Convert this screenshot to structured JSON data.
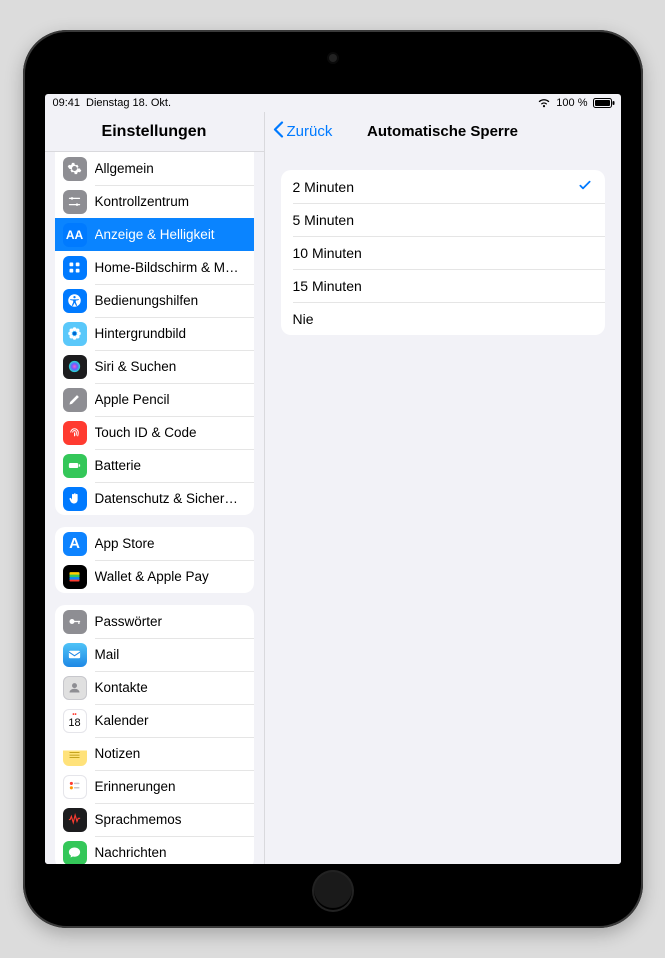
{
  "status_bar": {
    "time": "09:41",
    "date": "Dienstag 18. Okt.",
    "battery_pct": "100 %"
  },
  "sidebar": {
    "title": "Einstellungen",
    "groups": [
      {
        "items": [
          {
            "label": "Allgemein",
            "icon": "gear-icon",
            "color": "c-grey"
          },
          {
            "label": "Kontrollzentrum",
            "icon": "sliders-icon",
            "color": "c-grey"
          },
          {
            "label": "Anzeige & Helligkeit",
            "icon": "aa-icon",
            "color": "c-blue",
            "active": true
          },
          {
            "label": "Home-Bildschirm & Multi...",
            "icon": "grid-icon",
            "color": "c-blue"
          },
          {
            "label": "Bedienungshilfen",
            "icon": "accessibility-icon",
            "color": "c-blue"
          },
          {
            "label": "Hintergrundbild",
            "icon": "flower-icon",
            "color": "c-ltblue"
          },
          {
            "label": "Siri & Suchen",
            "icon": "siri-icon",
            "color": "c-siri"
          },
          {
            "label": "Apple Pencil",
            "icon": "pencil-icon",
            "color": "c-grey"
          },
          {
            "label": "Touch ID & Code",
            "icon": "fingerprint-icon",
            "color": "c-red"
          },
          {
            "label": "Batterie",
            "icon": "battery-icon",
            "color": "c-green"
          },
          {
            "label": "Datenschutz & Sicherheit",
            "icon": "hand-icon",
            "color": "c-blue"
          }
        ]
      },
      {
        "items": [
          {
            "label": "App Store",
            "icon": "appstore-icon",
            "color": "c-appstore"
          },
          {
            "label": "Wallet & Apple Pay",
            "icon": "wallet-icon",
            "color": "c-wallet"
          }
        ]
      },
      {
        "items": [
          {
            "label": "Passwörter",
            "icon": "key-icon",
            "color": "c-grey"
          },
          {
            "label": "Mail",
            "icon": "mail-icon",
            "color": "c-mail"
          },
          {
            "label": "Kontakte",
            "icon": "contacts-icon",
            "color": "c-contacts"
          },
          {
            "label": "Kalender",
            "icon": "calendar-icon",
            "color": "c-cal"
          },
          {
            "label": "Notizen",
            "icon": "notes-icon",
            "color": "c-notes"
          },
          {
            "label": "Erinnerungen",
            "icon": "reminders-icon",
            "color": "c-reminders"
          },
          {
            "label": "Sprachmemos",
            "icon": "voice-icon",
            "color": "c-voice"
          },
          {
            "label": "Nachrichten",
            "icon": "messages-icon",
            "color": "c-msg"
          }
        ]
      }
    ]
  },
  "detail": {
    "back_label": "Zurück",
    "title": "Automatische Sperre",
    "options": [
      {
        "label": "2 Minuten",
        "selected": true
      },
      {
        "label": "5 Minuten",
        "selected": false
      },
      {
        "label": "10 Minuten",
        "selected": false
      },
      {
        "label": "15 Minuten",
        "selected": false
      },
      {
        "label": "Nie",
        "selected": false
      }
    ]
  }
}
